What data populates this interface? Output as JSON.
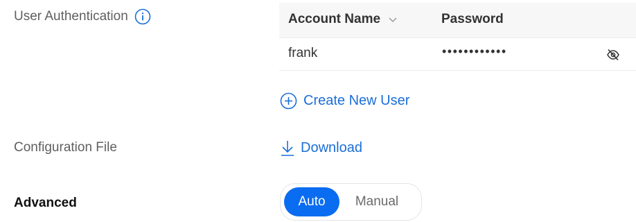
{
  "auth": {
    "label": "User Authentication",
    "info_icon": "info-circle-icon"
  },
  "table": {
    "columns": [
      "Account Name",
      "Password"
    ],
    "sort_icon": "chevron-down-icon",
    "rows": [
      {
        "account": "frank",
        "password": "••••••••••••",
        "visibility_icon": "eye-slash-icon"
      }
    ]
  },
  "create_user": {
    "label": "Create New User",
    "icon": "plus-circle-icon",
    "color": "#1a6ed8"
  },
  "config": {
    "label": "Configuration File",
    "download_label": "Download",
    "download_icon": "download-arrow-icon"
  },
  "advanced": {
    "label": "Advanced",
    "options": [
      "Auto",
      "Manual"
    ],
    "selected": "Auto",
    "accent": "#0a6cf0"
  }
}
